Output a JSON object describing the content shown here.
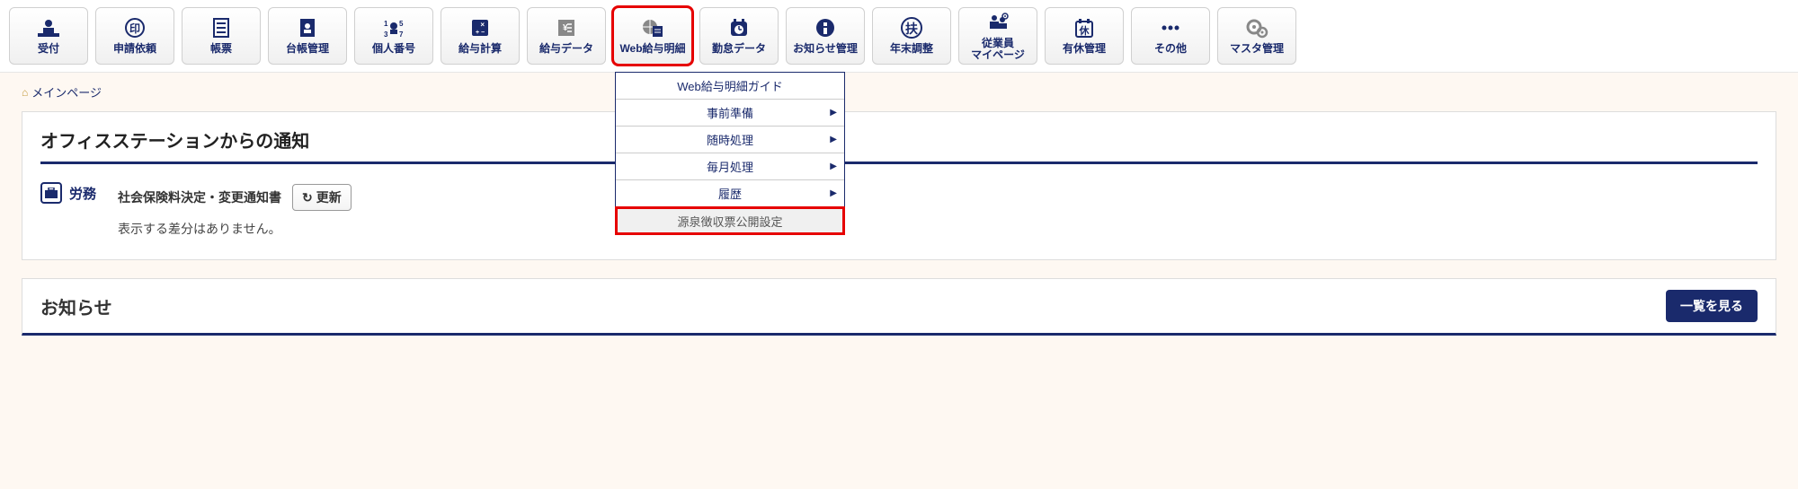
{
  "toolbar": [
    {
      "id": "reception",
      "label": "受付"
    },
    {
      "id": "request",
      "label": "申請依頼"
    },
    {
      "id": "form",
      "label": "帳票"
    },
    {
      "id": "ledger",
      "label": "台帳管理"
    },
    {
      "id": "mynumber",
      "label": "個人番号"
    },
    {
      "id": "payroll",
      "label": "給与計算"
    },
    {
      "id": "payrolldata",
      "label": "給与データ"
    },
    {
      "id": "webpay",
      "label": "Web給与明細",
      "highlight": true
    },
    {
      "id": "attend",
      "label": "勤怠データ"
    },
    {
      "id": "notice",
      "label": "お知らせ管理"
    },
    {
      "id": "yearend",
      "label": "年末調整"
    },
    {
      "id": "mypage",
      "label": "従業員\nマイページ"
    },
    {
      "id": "paidleave",
      "label": "有休管理"
    },
    {
      "id": "other",
      "label": "その他"
    },
    {
      "id": "master",
      "label": "マスタ管理"
    }
  ],
  "dropdown": {
    "items": [
      {
        "label": "Web給与明細ガイド",
        "arrow": false
      },
      {
        "label": "事前準備",
        "arrow": true
      },
      {
        "label": "随時処理",
        "arrow": true
      },
      {
        "label": "毎月処理",
        "arrow": true
      },
      {
        "label": "履歴",
        "arrow": true
      },
      {
        "label": "源泉徴収票公開設定",
        "arrow": false,
        "highlight": true
      }
    ]
  },
  "breadcrumb": {
    "label": "メインページ"
  },
  "panel1": {
    "title": "オフィスステーションからの通知",
    "badge": "労務",
    "heading": "社会保険料決定・変更通知書",
    "refresh": "更新",
    "body": "表示する差分はありません。"
  },
  "news": {
    "title": "お知らせ",
    "button": "一覧を見る"
  }
}
